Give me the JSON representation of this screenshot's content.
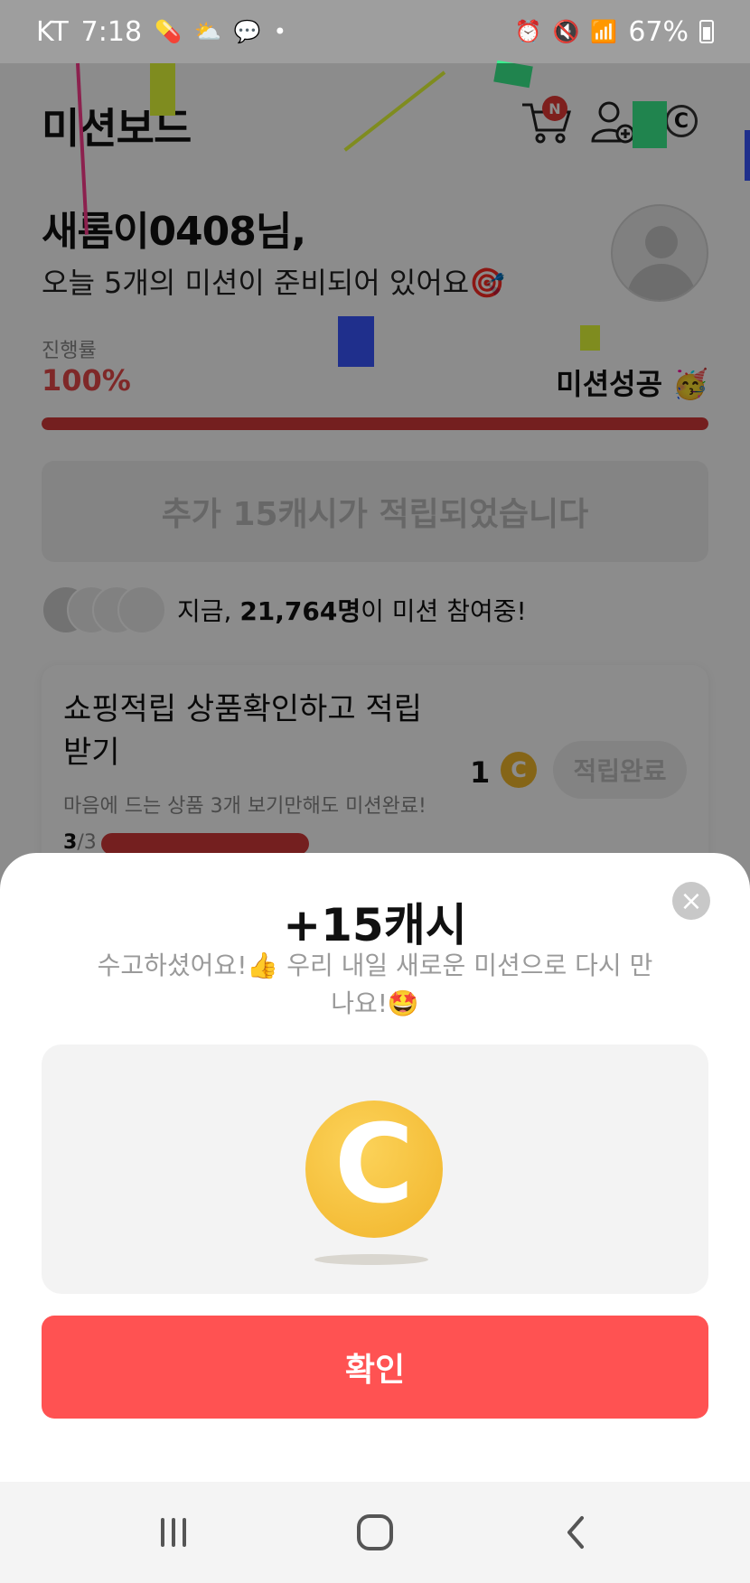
{
  "status_bar": {
    "carrier": "KT",
    "time": "7:18",
    "battery": "67%"
  },
  "header": {
    "title": "미션보드",
    "cart_badge": "N",
    "coin_symbol": "C"
  },
  "greeting": {
    "name": "새롬이0408님,",
    "subtitle": "오늘 5개의 미션이 준비되어 있어요🎯"
  },
  "progress": {
    "label": "진행률",
    "value": "100%",
    "fraction": 1.0,
    "status": "미션성공 🥳"
  },
  "banner": {
    "text": "추가 15캐시가 적립되었습니다"
  },
  "participants": {
    "prefix": "지금, ",
    "count": "21,764명",
    "suffix": "이 미션 참여중!"
  },
  "mission": {
    "title": "쇼핑적립 상품확인하고 적립받기",
    "description": "마음에 드는 상품 3개 보기만해도 미션완료!",
    "count_done": "3",
    "count_total": "/3",
    "reward": "1",
    "coin_symbol": "C",
    "button": "적립완료"
  },
  "sheet": {
    "title": "+15캐시",
    "message": "수고하셨어요!👍 우리 내일 새로운 미션으로 다시 만나요!🤩",
    "coin_symbol": "C",
    "close": "×",
    "confirm": "확인"
  },
  "colors": {
    "accent": "#ff5252",
    "progress": "#d43a3a",
    "coin": "#f2b82b"
  },
  "icons": {
    "cart": "cart-icon",
    "add_friend": "add-friend-icon",
    "coin": "coin-icon",
    "close": "close-icon",
    "nav_recent": "recent-apps-icon",
    "nav_home": "home-icon",
    "nav_back": "back-icon"
  }
}
